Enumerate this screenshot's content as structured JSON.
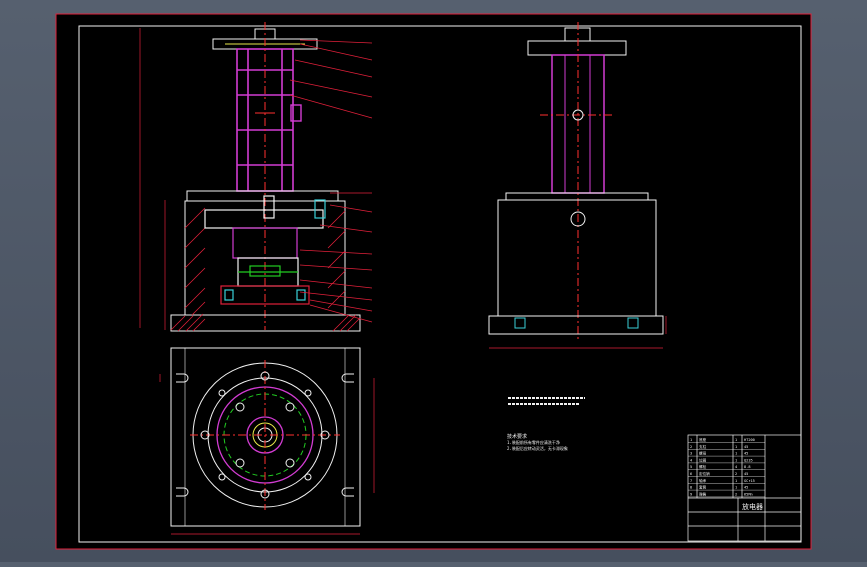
{
  "colors": {
    "background": "#4d5666",
    "paper": "#000000",
    "border": "#e0203a",
    "line_white": "#f2f2f2",
    "line_magenta": "#d23cd2",
    "line_green": "#22cc22",
    "line_red": "#ff3030",
    "line_yellow": "#e8e84a",
    "line_cyan": "#3ad0d8",
    "hatch": "#e0203a"
  },
  "title_block": {
    "part_title": "放电器",
    "rows": [
      [
        "1",
        "底座",
        "1",
        "HT200"
      ],
      [
        "2",
        "支柱",
        "1",
        "45"
      ],
      [
        "3",
        "螺母",
        "1",
        "45"
      ],
      [
        "4",
        "垃圈",
        "1",
        "Q235"
      ],
      [
        "5",
        "螺栓",
        "4",
        "8.8"
      ],
      [
        "6",
        "定位销",
        "2",
        "45"
      ],
      [
        "7",
        "轴承",
        "1",
        "GCr15"
      ],
      [
        "8",
        "套筒",
        "1",
        "45"
      ],
      [
        "9",
        "弹簧",
        "2",
        "65Mn"
      ]
    ]
  },
  "notes": {
    "header": "技术要求",
    "line1": "1.装配前所有零件应清洗干净",
    "line2": "2.装配后应转动灵活，无卡滞现象"
  }
}
